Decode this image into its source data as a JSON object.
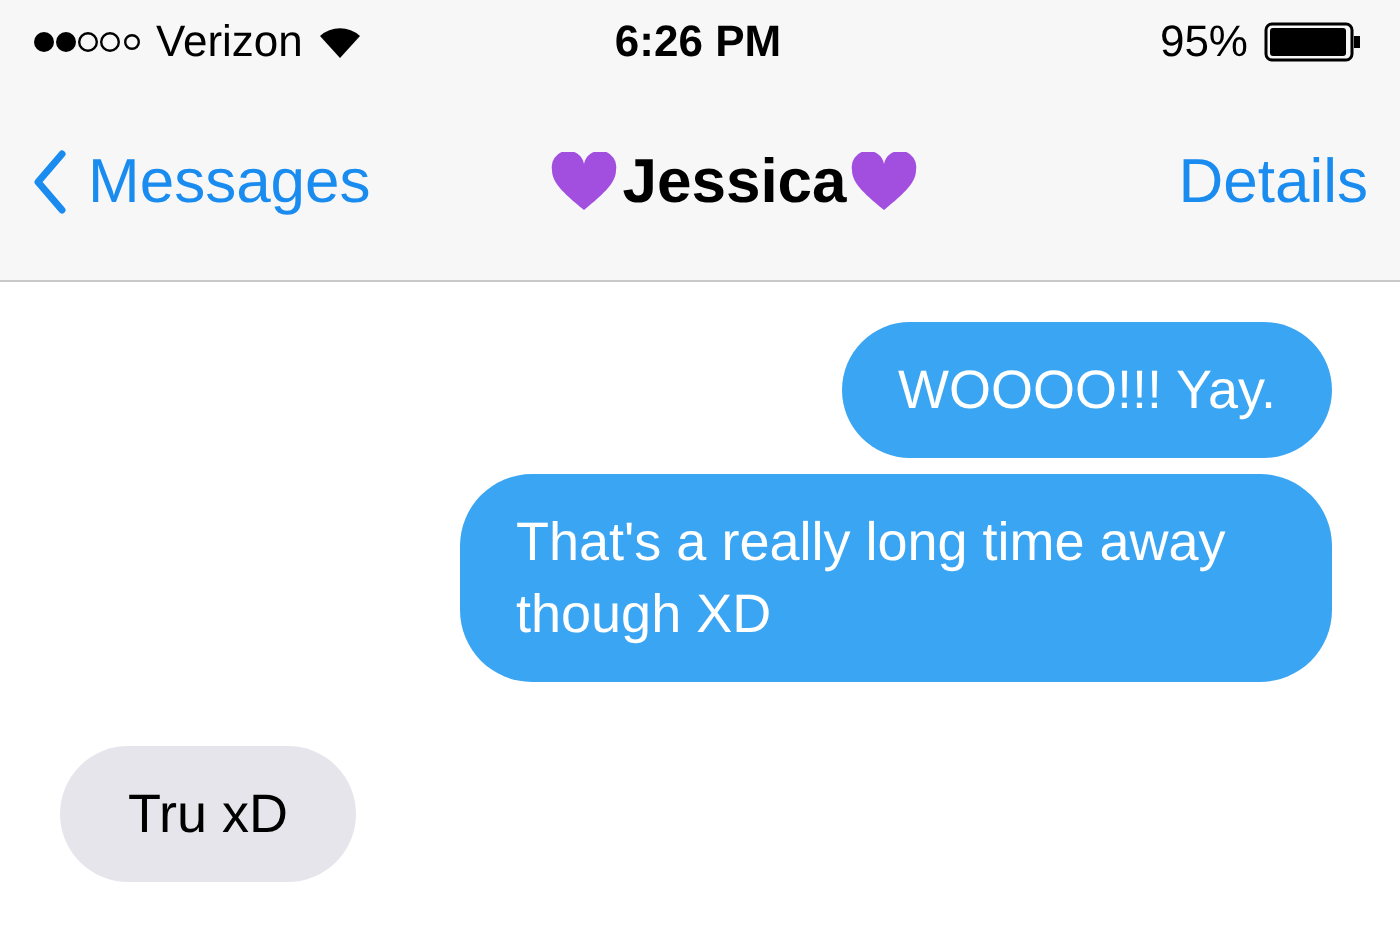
{
  "status_bar": {
    "carrier": "Verizon",
    "time": "6:26 PM",
    "battery": "95%"
  },
  "nav": {
    "back": "Messages",
    "title": "Jessica",
    "action": "Details"
  },
  "messages": [
    {
      "kind": "sent",
      "text": "WOOOO!!! Yay."
    },
    {
      "kind": "sent",
      "text": "That's a really long time away though XD"
    },
    {
      "kind": "received",
      "text": "Tru xD"
    }
  ]
}
